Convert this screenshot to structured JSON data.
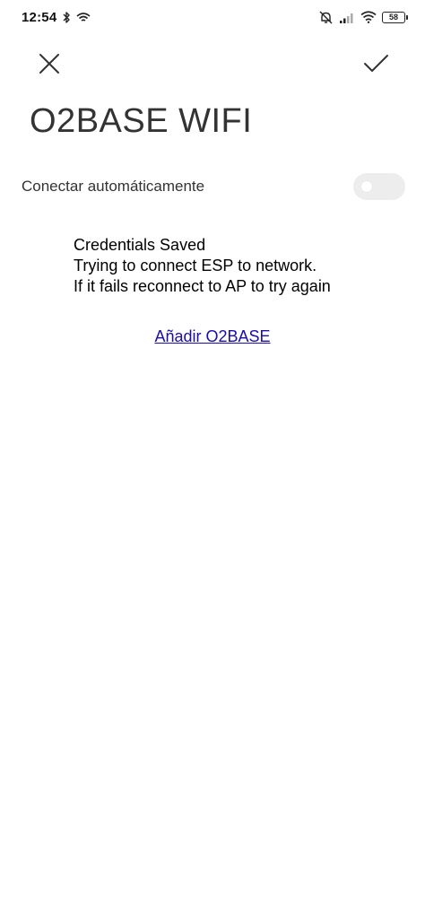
{
  "status_bar": {
    "time": "12:54",
    "battery_level": "58",
    "icons": [
      "bluetooth-icon",
      "hotspot-icon",
      "notifications-off-icon",
      "signal-icon",
      "wifi-icon",
      "battery-icon"
    ]
  },
  "action_bar": {
    "close_icon": "close-icon",
    "confirm_icon": "check-icon"
  },
  "page": {
    "title": "O2BASE WIFI",
    "auto_connect_label": "Conectar automáticamente",
    "auto_connect_enabled": false
  },
  "message": {
    "lines": [
      "Credentials Saved",
      "Trying to connect ESP to network.",
      "If it fails reconnect to AP to try again"
    ]
  },
  "link": {
    "label": "Añadir O2BASE"
  },
  "colors": {
    "background": "#ffffff",
    "link": "#1a0dab",
    "toggle_track": "#ededed"
  }
}
